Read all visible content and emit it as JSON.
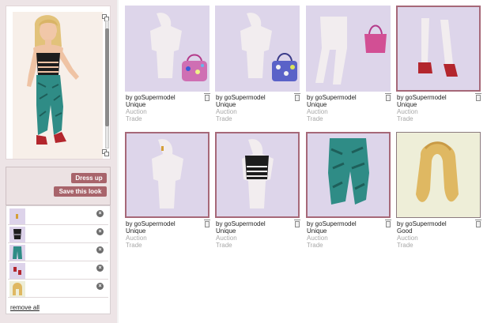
{
  "avatar_panel": {
    "dress_up_label": "Dress up",
    "save_look_label": "Save this look",
    "remove_all_label": "remove all",
    "wearing": [
      {
        "item": "shoes-icon",
        "thumb_color": "#ddd3ea"
      },
      {
        "item": "black-top-icon",
        "thumb_color": "#ddd3ea"
      },
      {
        "item": "teal-pants-icon",
        "thumb_color": "#ddd3ea"
      },
      {
        "item": "red-shoes-icon",
        "thumb_color": "#ddd3ea"
      },
      {
        "item": "blonde-hair-icon",
        "thumb_color": "#eeeed8"
      }
    ]
  },
  "items": [
    {
      "by": "by goSupermodel",
      "rarity": "Unique",
      "auction": "Auction",
      "trade": "Trade",
      "item": "pink-handbag-icon"
    },
    {
      "by": "by goSupermodel",
      "rarity": "Unique",
      "auction": "Auction",
      "trade": "Trade",
      "item": "blue-handbag-icon"
    },
    {
      "by": "by goSupermodel",
      "rarity": "Unique",
      "auction": "Auction",
      "trade": "Trade",
      "item": "pink-bag-on-mannequin-icon"
    },
    {
      "by": "by goSupermodel",
      "rarity": "Unique",
      "auction": "Auction",
      "trade": "Trade",
      "item": "red-shoes-icon"
    },
    {
      "by": "by goSupermodel",
      "rarity": "Unique",
      "auction": "Auction",
      "trade": "Trade",
      "item": "earring-icon"
    },
    {
      "by": "by goSupermodel",
      "rarity": "Unique",
      "auction": "Auction",
      "trade": "Trade",
      "item": "black-top-icon"
    },
    {
      "by": "by goSupermodel",
      "rarity": "Unique",
      "auction": "Auction",
      "trade": "Trade",
      "item": "teal-pants-icon"
    },
    {
      "by": "by goSupermodel",
      "rarity": "Good",
      "auction": "Auction",
      "trade": "Trade",
      "item": "blonde-hair-icon"
    }
  ],
  "colors": {
    "accent": "#a8646b",
    "card_bg": "#ddd5ea",
    "card_selected_border": "#a66878",
    "hair_card_bg": "#eeeed8",
    "panel_bg": "#ede4e6",
    "muted_text": "#a8a8a8"
  }
}
